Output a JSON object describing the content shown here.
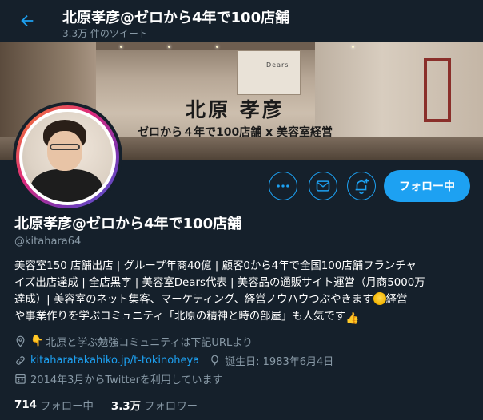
{
  "header": {
    "title": "北原孝彦@ゼロから4年で100店舗",
    "tweet_count": "3.3万 件のツイート"
  },
  "banner": {
    "name": "北原 孝彦",
    "tagline": "ゼロから４年で100店舗 x 美容室経営",
    "sign_text": "Dears"
  },
  "actions": {
    "follow_label": "フォロー中"
  },
  "profile": {
    "display_name": "北原孝彦@ゼロから4年で100店舗",
    "handle": "@kitahara64",
    "bio_lines": [
      "美容室150 店舗出店 | グループ年商40億 | 顧客0から4年で全国100店舗フランチャ",
      "イズ出店達成 | 全店黒字 | 美容室Dears代表 | 美容品の通販サイト運営（月商5000万",
      "達成）| 美容室のネット集客、マーケティング、経営ノウハウつぶやきます",
      "経営",
      "や事業作りを学ぶコミュニティ「北原の精神と時の部屋」も人気です"
    ],
    "location": "北原と学ぶ勉強コミュニティは下記URLより",
    "url": "kitaharatakahiko.jp/t-tokinoheya",
    "birthday": "誕生日: 1983年6月4日",
    "joined": "2014年3月からTwitterを利用しています"
  },
  "stats": {
    "following_count": "714",
    "following_label": "フォロー中",
    "followers_count": "3.3万",
    "followers_label": "フォロワー"
  },
  "icons": {
    "back": "arrow-left-icon",
    "more": "more-dots-icon",
    "message": "envelope-icon",
    "notify": "bell-plus-icon",
    "location": "location-pin-icon",
    "link": "link-icon",
    "birthday": "balloon-icon",
    "calendar": "calendar-icon"
  },
  "colors": {
    "background": "#15202b",
    "accent": "#1da1f2",
    "secondary_text": "#8899a6"
  }
}
